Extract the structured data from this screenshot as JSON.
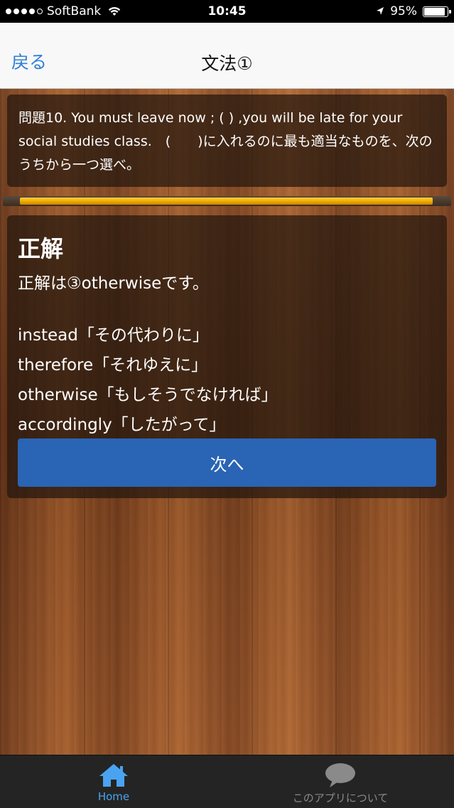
{
  "status_bar": {
    "carrier": "SoftBank",
    "time": "10:45",
    "battery_percent": "95%",
    "battery_level": 0.95,
    "signal_bars": 4
  },
  "nav": {
    "back_label": "戻る",
    "title": "文法①"
  },
  "question": {
    "text": "問題10. You must leave now ; ( ) ,you will be late for your social studies class.　(　　)に入れるのに最も適当なものを、次のうちから一つ選べ。"
  },
  "progress": {
    "fraction": 0.96
  },
  "answer": {
    "title": "正解",
    "text": "正解は③otherwiseです。",
    "choices": [
      "instead「その代わりに」",
      "therefore「それゆえに」",
      "otherwise「もしそうでなければ」",
      "accordingly「したがって」"
    ],
    "next_label": "次へ"
  },
  "tabs": [
    {
      "label": "Home",
      "icon": "home-icon",
      "color": "#4aa3f0"
    },
    {
      "label": "このアプリについて",
      "icon": "speech-bubble-icon",
      "color": "#8a8a8a"
    }
  ]
}
